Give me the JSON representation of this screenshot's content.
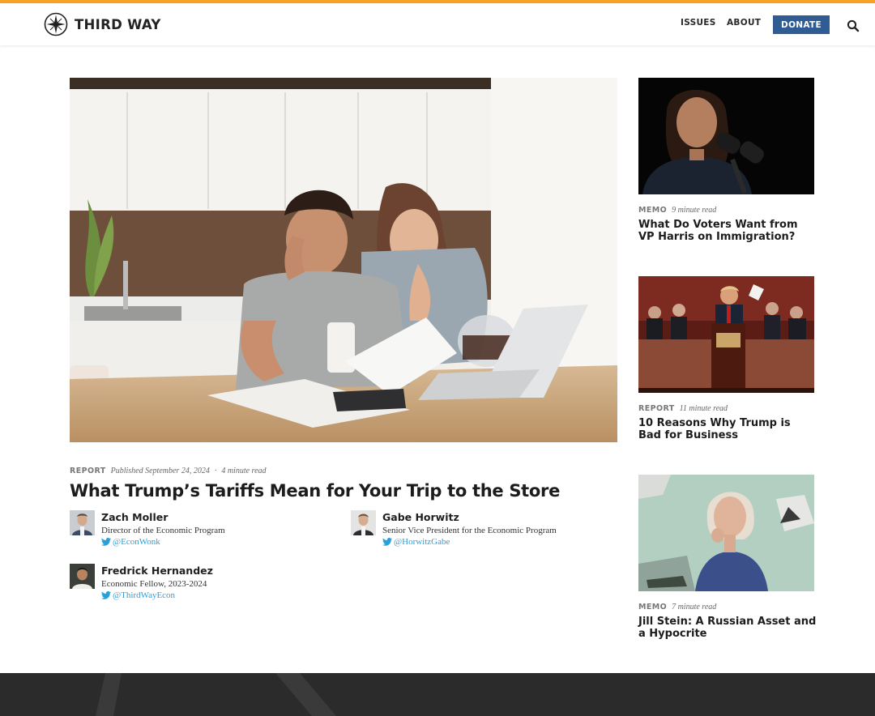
{
  "brand": {
    "name": "THIRD WAY",
    "accent": "#f7a325",
    "donate_color": "#2f5c93"
  },
  "nav": {
    "issues": "ISSUES",
    "about": "ABOUT",
    "donate": "DONATE"
  },
  "feature": {
    "type": "REPORT",
    "published": "Published September 24, 2024",
    "separator": "·",
    "read_time": "4 minute read",
    "title": "What Trump’s Tariffs Mean for Your Trip to the Store",
    "authors": [
      {
        "name": "Zach Moller",
        "role": "Director of the Economic Program",
        "twitter": "@EconWonk"
      },
      {
        "name": "Gabe Horwitz",
        "role": "Senior Vice President for the Economic Program",
        "twitter": "@HorwitzGabe"
      },
      {
        "name": "Fredrick Hernandez",
        "role": "Economic Fellow, 2023-2024",
        "twitter": "@ThirdWayEcon"
      }
    ]
  },
  "sidebar": [
    {
      "type": "MEMO",
      "read_time": "9 minute read",
      "title": "What Do Voters Want from VP Harris on Immigration?"
    },
    {
      "type": "REPORT",
      "read_time": "11 minute read",
      "title": "10 Reasons Why Trump is Bad for Business"
    },
    {
      "type": "MEMO",
      "read_time": "7 minute read",
      "title": "Jill Stein: A Russian Asset and a Hypocrite"
    }
  ],
  "icons": {
    "logo": "compass-icon",
    "search": "search-icon",
    "twitter": "twitter-icon"
  }
}
